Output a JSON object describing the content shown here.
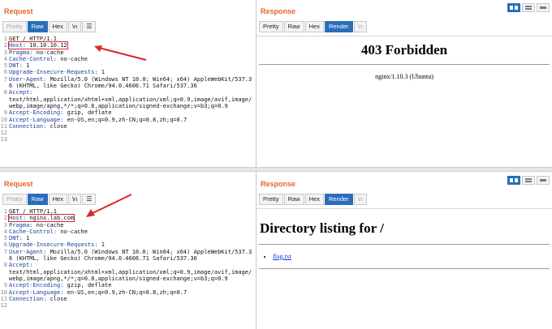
{
  "top": {
    "request": {
      "title": "Request",
      "tabs": [
        "Pretty",
        "Raw",
        "Hex",
        "\\n",
        "☰"
      ],
      "selected_tab": "Raw",
      "lines": [
        {
          "n": "1",
          "name": "",
          "value": "GET / HTTP/1.1"
        },
        {
          "n": "2",
          "name": "Host:",
          "value": " 10.10.10.12"
        },
        {
          "n": "3",
          "name": "Pragma:",
          "value": " no-cache"
        },
        {
          "n": "4",
          "name": "Cache-Control:",
          "value": " no-cache"
        },
        {
          "n": "5",
          "name": "DNT:",
          "value": " 1"
        },
        {
          "n": "6",
          "name": "Upgrade-Insecure-Requests:",
          "value": " 1"
        },
        {
          "n": "7",
          "name": "User-Agent:",
          "value": " Mozilla/5.0 (Windows NT 10.0; Win64; x64) AppleWebKit/537.36 (KHTML, like Gecko) Chrome/94.0.4606.71 Safari/537.36"
        },
        {
          "n": "8",
          "name": "Accept:",
          "value": "\ntext/html,application/xhtml+xml,application/xml;q=0.9,image/avif,image/webp,image/apng,*/*;q=0.8,application/signed-exchange;v=b3;q=0.9"
        },
        {
          "n": "9",
          "name": "Accept-Encoding:",
          "value": " gzip, deflate"
        },
        {
          "n": "10",
          "name": "Accept-Language:",
          "value": " en-US,en;q=0.9,zh-CN;q=0.8,zh;q=0.7"
        },
        {
          "n": "11",
          "name": "Connection:",
          "value": " close"
        },
        {
          "n": "12",
          "name": "",
          "value": ""
        },
        {
          "n": "13",
          "name": "",
          "value": ""
        }
      ]
    },
    "response": {
      "title": "Response",
      "tabs": [
        "Pretty",
        "Raw",
        "Hex",
        "Render",
        "\\n"
      ],
      "selected_tab": "Render",
      "heading": "403 Forbidden",
      "server": "nginx/1.10.3 (Ubuntu)"
    }
  },
  "bottom": {
    "request": {
      "title": "Request",
      "tabs": [
        "Pretty",
        "Raw",
        "Hex",
        "\\n",
        "☰"
      ],
      "selected_tab": "Raw",
      "lines": [
        {
          "n": "1",
          "name": "",
          "value": "GET / HTTP/1.1"
        },
        {
          "n": "2",
          "name": "Host:",
          "value": " nginx.lab.com"
        },
        {
          "n": "3",
          "name": "Pragma:",
          "value": " no-cache"
        },
        {
          "n": "4",
          "name": "Cache-Control:",
          "value": " no-cache"
        },
        {
          "n": "5",
          "name": "DNT:",
          "value": " 1"
        },
        {
          "n": "6",
          "name": "Upgrade-Insecure-Requests:",
          "value": " 1"
        },
        {
          "n": "7",
          "name": "User-Agent:",
          "value": " Mozilla/5.0 (Windows NT 10.0; Win64; x64) AppleWebKit/537.36 (KHTML, like Gecko) Chrome/94.0.4606.71 Safari/537.36"
        },
        {
          "n": "8",
          "name": "Accept:",
          "value": "\ntext/html,application/xhtml+xml,application/xml;q=0.9,image/avif,image/webp,image/apng,*/*;q=0.8,application/signed-exchange;v=b3;q=0.9"
        },
        {
          "n": "9",
          "name": "Accept-Encoding:",
          "value": " gzip, deflate"
        },
        {
          "n": "10",
          "name": "Accept-Language:",
          "value": " en-US,en;q=0.9,zh-CN;q=0.8,zh;q=0.7"
        },
        {
          "n": "11",
          "name": "Connection:",
          "value": " close"
        },
        {
          "n": "12",
          "name": "",
          "value": ""
        }
      ]
    },
    "response": {
      "title": "Response",
      "tabs": [
        "Pretty",
        "Raw",
        "Hex",
        "Render",
        "\\n"
      ],
      "selected_tab": "Render",
      "heading": "Directory listing for /",
      "files": [
        "flag.txt"
      ]
    }
  },
  "icons": {
    "view_buttons": [
      "layout-split-icon",
      "layout-horizontal-icon",
      "layout-single-icon"
    ],
    "annotation": "red-arrow-icon"
  },
  "colors": {
    "accent": "#e8622a",
    "selected_tab": "#2a6ebb",
    "highlight_box": "#d9262c",
    "header_name": "#1a3d9e",
    "link": "#0b3bd6"
  }
}
